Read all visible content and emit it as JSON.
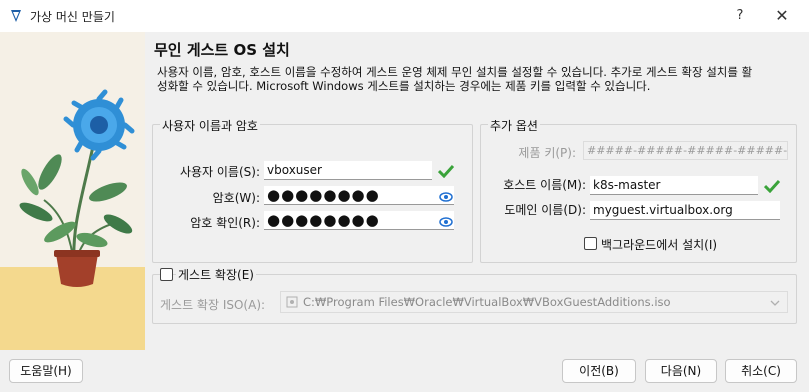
{
  "window": {
    "title": "가상 머신 만들기",
    "help_glyph": "?",
    "close_glyph": "✕"
  },
  "page": {
    "heading": "무인 게스트 OS 설치",
    "description": "사용자 이름, 암호, 호스트 이름을 수정하여 게스트 운영 체제 무인 설치를 설정할 수 있습니다. 추가로 게스트 확장 설치를 활성화할 수 있습니다. Microsoft Windows 게스트를 설치하는 경우에는 제품 키를 입력할 수 있습니다."
  },
  "user_group": {
    "title": "사용자 이름과 암호",
    "username_label": "사용자 이름(S):",
    "username_value": "vboxuser",
    "password_label": "암호(W):",
    "password_value": "●●●●●●●●",
    "confirm_label": "암호 확인(R):",
    "confirm_value": "●●●●●●●●"
  },
  "extra_group": {
    "title": "추가 옵션",
    "product_key_label": "제품 키(P):",
    "product_key_placeholder": "#####-#####-#####-#####-#####",
    "hostname_label": "호스트 이름(M):",
    "hostname_value": "k8s-master",
    "domain_label": "도메인 이름(D):",
    "domain_value": "myguest.virtualbox.org",
    "background_install_label": "백그라운드에서 설치(I)"
  },
  "ga_group": {
    "checkbox_label": "게스트 확장(E)",
    "iso_label": "게스트 확장 ISO(A):",
    "iso_path": "C:₩Program Files₩Oracle₩VirtualBox₩VBoxGuestAdditions.iso"
  },
  "buttons": {
    "help": "도움말(H)",
    "back": "이전(B)",
    "next": "다음(N)",
    "cancel": "취소(C)"
  },
  "colors": {
    "valid_check": "#3aa33a",
    "eye_icon": "#1f6fd1",
    "flower": "#2f8fd6",
    "pot": "#a3402a",
    "table": "#f4d98e"
  }
}
